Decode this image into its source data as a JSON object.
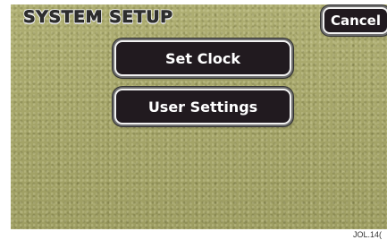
{
  "screen": {
    "title": "SYSTEM SETUP",
    "cancel_label": "Cancel",
    "menu": [
      {
        "label": "Set Clock"
      },
      {
        "label": "User Settings"
      }
    ]
  },
  "footer": {
    "code": "JOL.14("
  },
  "colors": {
    "background_texture": "#a8a86c",
    "button_fill": "#211a1f",
    "button_border": "#f2f2f2",
    "button_text": "#ffffff",
    "title_text": "#2e2e2e"
  }
}
